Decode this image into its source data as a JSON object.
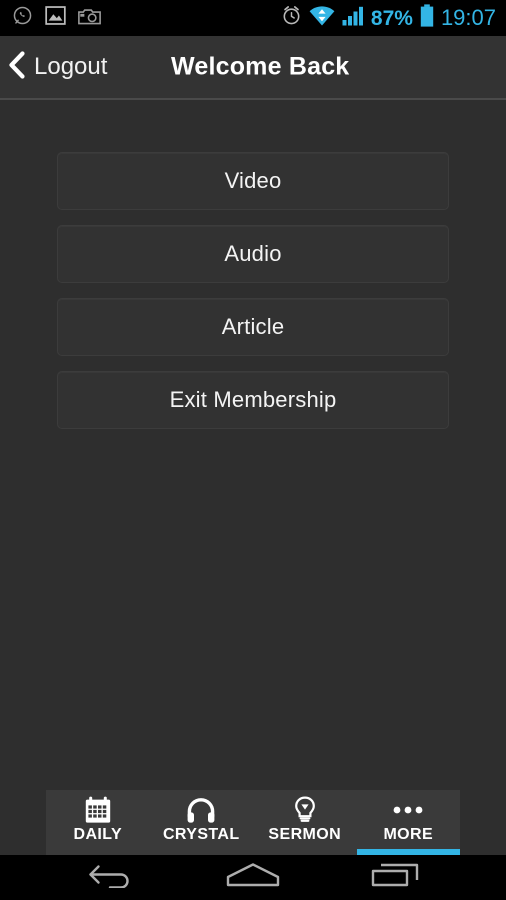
{
  "statusbar": {
    "left_icons": [
      {
        "name": "whatsapp-icon",
        "label": "WhatsApp"
      },
      {
        "name": "gallery-icon",
        "label": "Gallery"
      },
      {
        "name": "camera-icon",
        "label": "Camera"
      }
    ],
    "right_icons": [
      {
        "name": "alarm-clock-icon",
        "label": "Alarm"
      },
      {
        "name": "wifi-icon",
        "label": "Wi-Fi"
      },
      {
        "name": "signal-bars-icon",
        "label": "Signal"
      }
    ],
    "battery_percent": "87%",
    "battery_icon": "battery-full-icon",
    "clock": "19:07",
    "accent_color": "#33b5e5",
    "background_color": "#000000"
  },
  "actionbar": {
    "back_icon": "chevron-left-icon",
    "back_label": "Logout",
    "title": "Welcome Back",
    "background_color": "#333333"
  },
  "main": {
    "background_color": "#2e2e2e",
    "buttons": [
      {
        "name": "video-button",
        "label": "Video"
      },
      {
        "name": "audio-button",
        "label": "Audio"
      },
      {
        "name": "article-button",
        "label": "Article"
      },
      {
        "name": "exit-membership-button",
        "label": "Exit Membership"
      }
    ]
  },
  "tabbar": {
    "background_color": "#3a3a3a",
    "active_indicator_color": "#33b5e5",
    "tabs": [
      {
        "name": "tab-daily",
        "label": "DAILY",
        "icon": "calendar-icon",
        "active": false
      },
      {
        "name": "tab-crystal",
        "label": "CRYSTAL",
        "icon": "headphones-icon",
        "active": false
      },
      {
        "name": "tab-sermon",
        "label": "SERMON",
        "icon": "lightbulb-icon",
        "active": false
      },
      {
        "name": "tab-more",
        "label": "MORE",
        "icon": "more-dots-icon",
        "active": true
      }
    ]
  },
  "navbar": {
    "buttons": [
      {
        "name": "nav-back-button",
        "icon": "back-arrow-icon"
      },
      {
        "name": "nav-home-button",
        "icon": "home-icon"
      },
      {
        "name": "nav-recents-button",
        "icon": "recents-icon"
      }
    ]
  }
}
